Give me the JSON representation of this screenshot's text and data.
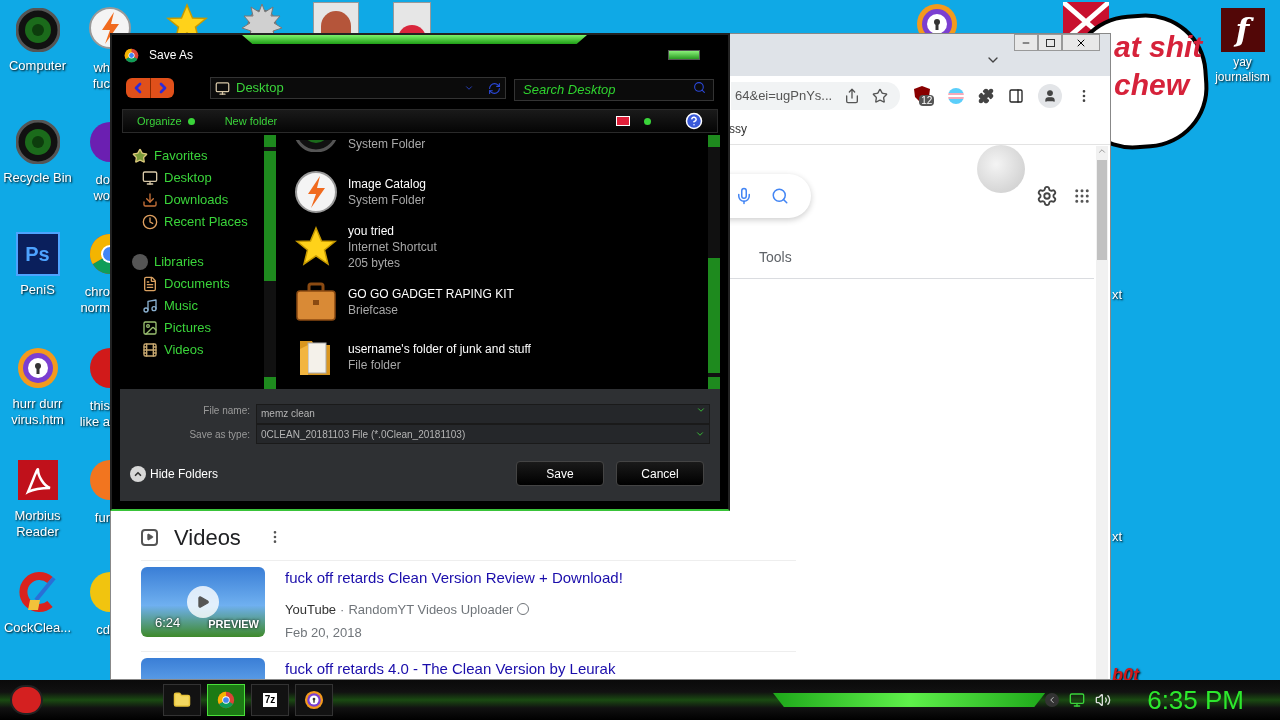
{
  "desktop": {
    "icons": [
      {
        "kind": "disc",
        "lines": [
          "Computer"
        ]
      },
      {
        "kind": "disc",
        "lines": [
          "Recycle Bin"
        ]
      },
      {
        "kind": "ps",
        "logo": "Ps",
        "lines": [
          "PeniS"
        ]
      },
      {
        "kind": "shield",
        "lines": [
          "hurr durr",
          "virus.htm"
        ]
      },
      {
        "kind": "pdf",
        "lines": [
          "Morbius",
          "Reader"
        ]
      },
      {
        "kind": "cleaner",
        "lines": [
          "CockClea..."
        ]
      }
    ],
    "partial_icons": [
      {
        "kind": "bolt",
        "lines": [
          "wh",
          "fuc"
        ]
      },
      {
        "kind": "yahoo",
        "lines": [
          "do",
          "wo"
        ]
      },
      {
        "kind": "chrome",
        "lines": [
          "chro",
          "norm"
        ]
      },
      {
        "kind": "red",
        "lines": [
          "this",
          "like a"
        ]
      },
      {
        "kind": "firefox",
        "lines": [
          "fur"
        ]
      },
      {
        "kind": "yellow",
        "lines": [
          "cd"
        ]
      }
    ],
    "right_icon": {
      "logo": "f",
      "lines": [
        "yay",
        "journalism"
      ]
    },
    "sticker": {
      "lines": [
        "at shit",
        "chew"
      ]
    },
    "edge_texts": [
      "xt",
      "xt",
      "b0t"
    ]
  },
  "browser": {
    "url": "64&ei=ugPnYs...",
    "extension_badge": "12",
    "bookmark": "ssy",
    "tools": "Tools",
    "videos": {
      "heading": "Videos",
      "results": [
        {
          "title": "fuck off retards Clean Version Review + Download!",
          "duration": "6:24",
          "preview": "PREVIEW",
          "source": "YouTube",
          "separator": "·",
          "channel": "RandomYT Videos Uploader",
          "date": "Feb 20, 2018"
        },
        {
          "title": "fuck off retards 4.0 - The Clean Version by Leurak"
        }
      ]
    }
  },
  "dialog": {
    "title": "Save As",
    "location": "Desktop",
    "search_placeholder": "Search Desktop",
    "toolbar": [
      {
        "kind": "menu",
        "label": "Organize"
      },
      {
        "kind": "button",
        "label": "New folder"
      }
    ],
    "nav": [
      {
        "label": "Favorites",
        "kind": "star",
        "items": [
          {
            "label": "Desktop",
            "kind": "desktop"
          },
          {
            "label": "Downloads",
            "kind": "downloads"
          },
          {
            "label": "Recent Places",
            "kind": "recent"
          }
        ]
      },
      {
        "label": "Libraries",
        "kind": "libraries",
        "items": [
          {
            "label": "Documents",
            "kind": "documents"
          },
          {
            "label": "Music",
            "kind": "music"
          },
          {
            "label": "Pictures",
            "kind": "pictures"
          },
          {
            "label": "Videos",
            "kind": "videos"
          }
        ]
      }
    ],
    "files": [
      {
        "kind": "disc",
        "details": [
          "System Folder"
        ]
      },
      {
        "kind": "bolt",
        "name": "Image Catalog",
        "details": [
          "System Folder"
        ]
      },
      {
        "kind": "star",
        "name": "you tried",
        "details": [
          "Internet Shortcut",
          "205 bytes"
        ]
      },
      {
        "kind": "briefcase",
        "name": "GO GO GADGET RAPING KIT",
        "details": [
          "Briefcase"
        ]
      },
      {
        "kind": "folder",
        "name": "username's folder of junk and stuff",
        "details": [
          "File folder"
        ]
      }
    ],
    "file_name": {
      "label": "File name:",
      "value": "memz clean"
    },
    "save_type": {
      "label": "Save as type:",
      "value": "0CLEAN_20181103 File (*.0Clean_20181103)"
    },
    "hide_folders": "Hide Folders",
    "buttons": [
      "Save",
      "Cancel"
    ]
  },
  "taskbar": {
    "buttons": [
      {
        "kind": "folder",
        "selected": false
      },
      {
        "kind": "chrome",
        "selected": true
      },
      {
        "kind": "archive",
        "label": "7z",
        "selected": false
      },
      {
        "kind": "shield",
        "selected": false
      }
    ],
    "clock": "6:35 PM"
  }
}
